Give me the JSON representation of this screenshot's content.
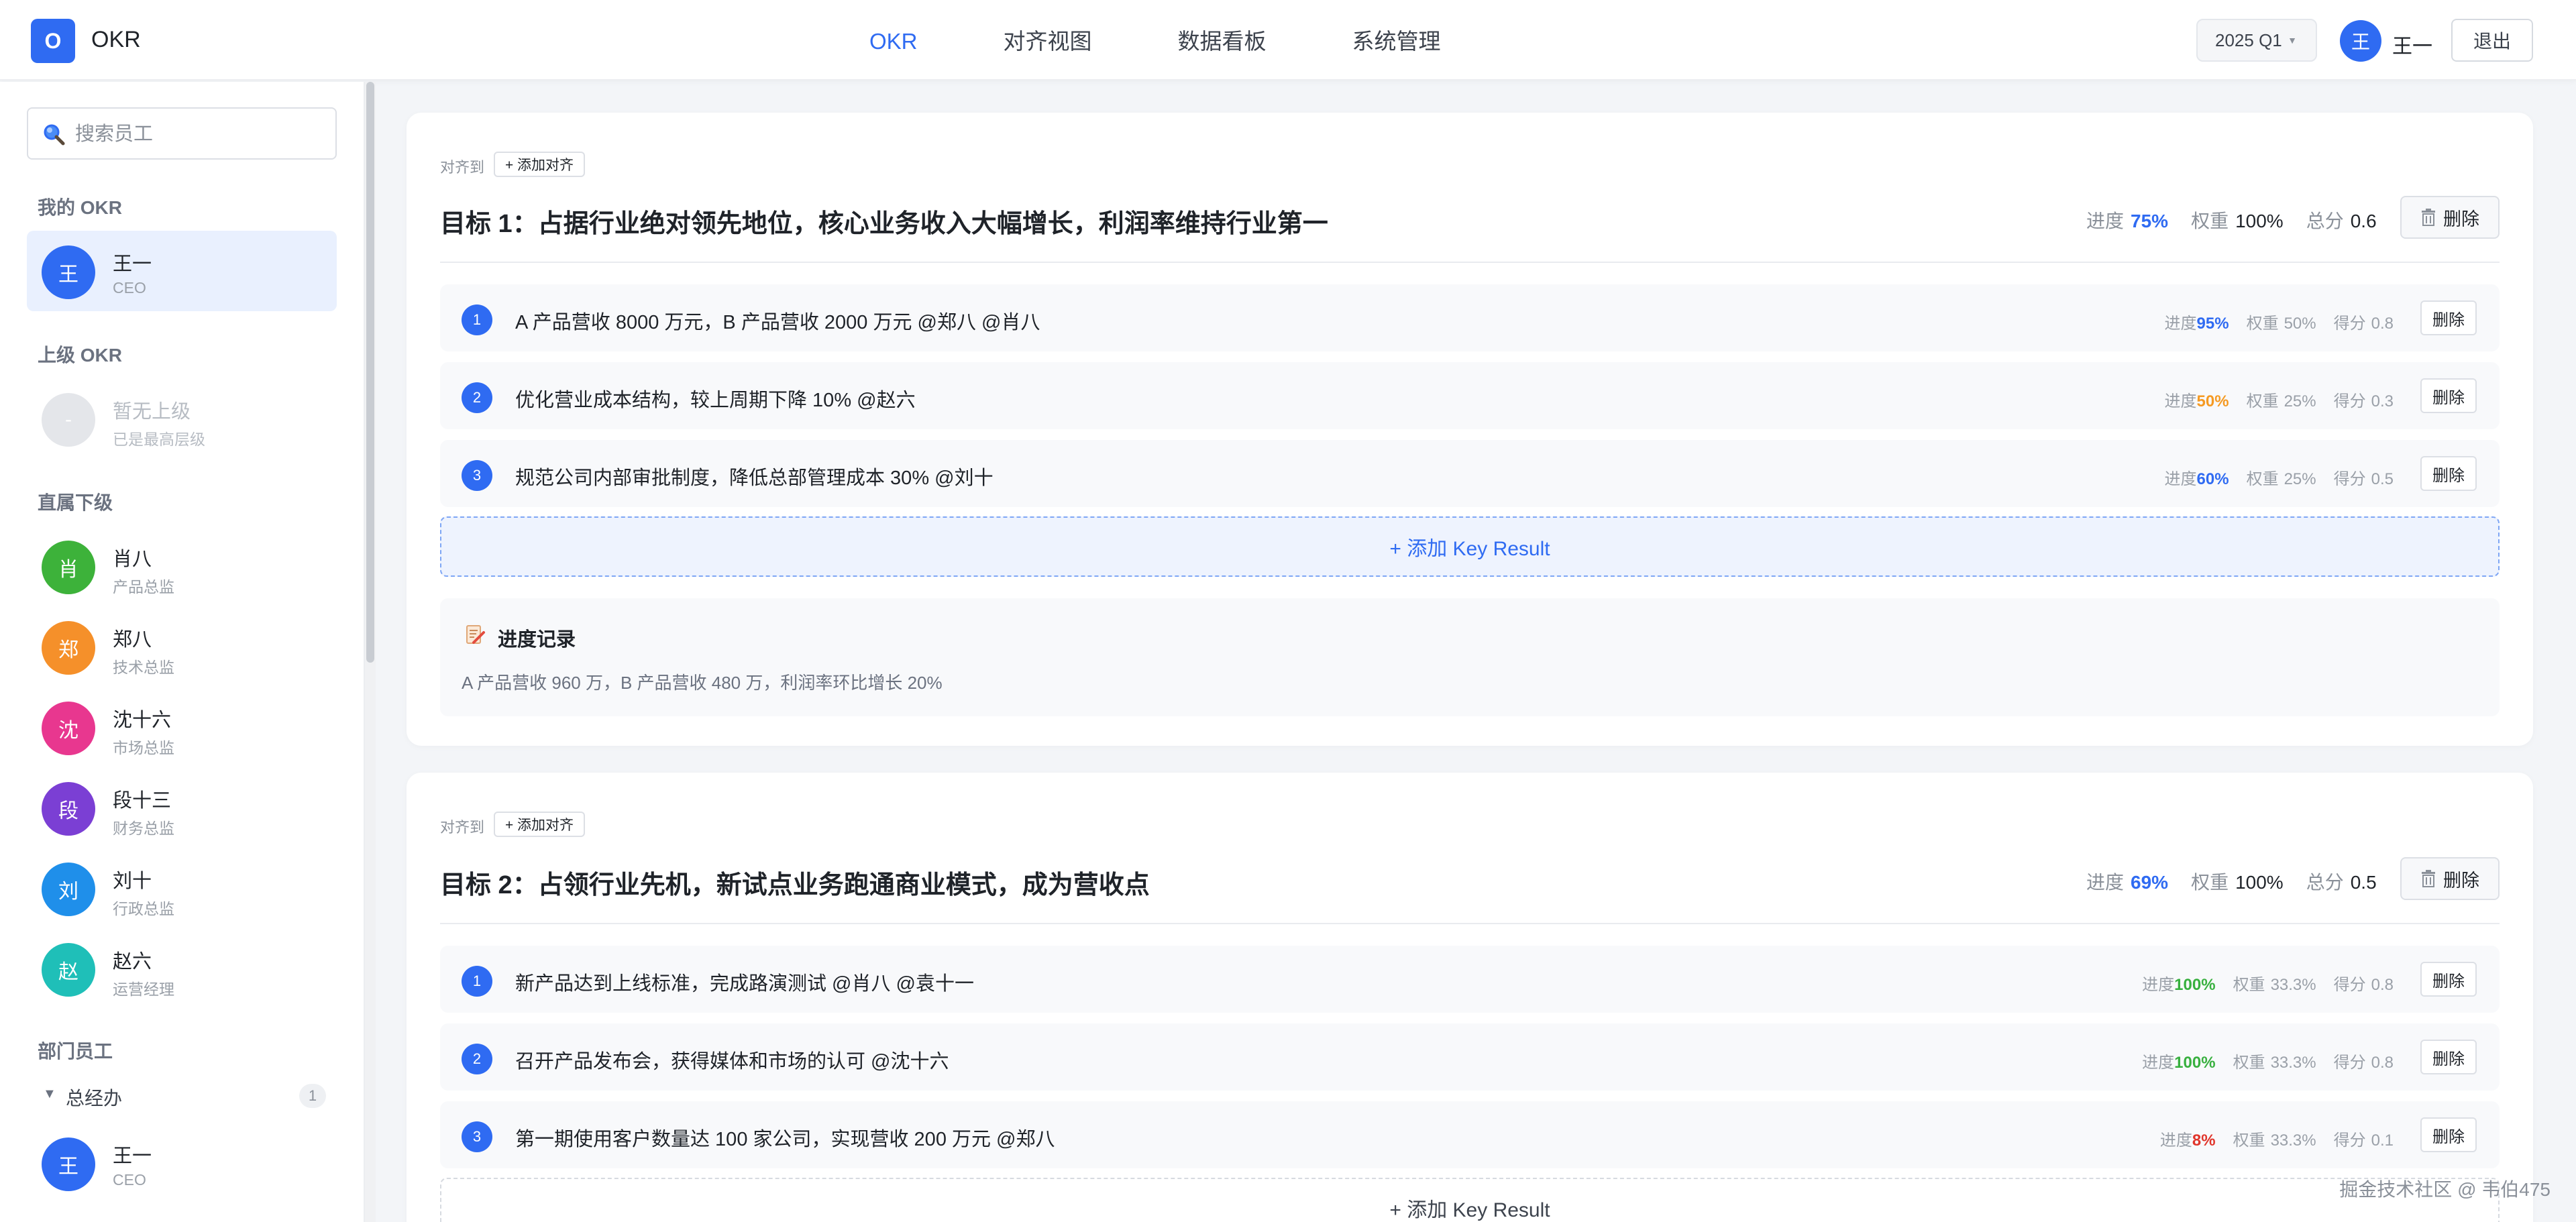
{
  "header": {
    "logo_letter": "O",
    "app_title": "OKR",
    "nav": [
      {
        "label": "OKR",
        "active": true
      },
      {
        "label": "对齐视图",
        "active": false
      },
      {
        "label": "数据看板",
        "active": false
      },
      {
        "label": "系统管理",
        "active": false
      }
    ],
    "quarter": "2025 Q1",
    "user_avatar": "王",
    "user_name": "王一",
    "logout_label": "退出"
  },
  "sidebar": {
    "search_placeholder": "搜索员工",
    "my_okr_label": "我的 OKR",
    "me": {
      "avatar": "王",
      "name": "王一",
      "role": "CEO",
      "color": "#2f6bf2"
    },
    "superior_label": "上级 OKR",
    "superior": {
      "avatar": "-",
      "name": "暂无上级",
      "role": "已是最高层级",
      "color": "#e4e6ea"
    },
    "subordinates_label": "直属下级",
    "subordinates": [
      {
        "avatar": "肖",
        "name": "肖八",
        "role": "产品总监",
        "color": "#3db23a"
      },
      {
        "avatar": "郑",
        "name": "郑八",
        "role": "技术总监",
        "color": "#f5902a"
      },
      {
        "avatar": "沈",
        "name": "沈十六",
        "role": "市场总监",
        "color": "#e8378f"
      },
      {
        "avatar": "段",
        "name": "段十三",
        "role": "财务总监",
        "color": "#7b3fd4"
      },
      {
        "avatar": "刘",
        "name": "刘十",
        "role": "行政总监",
        "color": "#1f8fea"
      },
      {
        "avatar": "赵",
        "name": "赵六",
        "role": "运营经理",
        "color": "#1fbfb8"
      }
    ],
    "department_label": "部门员工",
    "department": {
      "name": "总经办",
      "count": "1"
    },
    "department_member": {
      "avatar": "王",
      "name": "王一",
      "role": "CEO",
      "color": "#2f6bf2"
    }
  },
  "objectives": [
    {
      "align_label": "对齐到",
      "add_align_label": "+ 添加对齐",
      "title": "目标 1：占据行业绝对领先地位，核心业务收入大幅增长，利润率维持行业第一",
      "progress_label": "进度",
      "progress": "75%",
      "weight_label": "权重",
      "weight": "100%",
      "score_label": "总分",
      "score": "0.6",
      "delete_label": "删除",
      "key_results": [
        {
          "num": "1",
          "text": "A 产品营收 8000 万元，B 产品营收 2000 万元 @郑八 @肖八",
          "progress": "95%",
          "progress_color": "blue",
          "weight": "50%",
          "score": "0.8"
        },
        {
          "num": "2",
          "text": "优化营业成本结构，较上周期下降 10% @赵六",
          "progress": "50%",
          "progress_color": "orange",
          "weight": "25%",
          "score": "0.3"
        },
        {
          "num": "3",
          "text": "规范公司内部审批制度，降低总部管理成本 30% @刘十",
          "progress": "60%",
          "progress_color": "blue",
          "weight": "25%",
          "score": "0.5"
        }
      ],
      "add_kr_label": "+ 添加 Key Result",
      "progress_log": {
        "title": "进度记录",
        "text": "A 产品营收 960 万，B 产品营收 480 万，利润率环比增长 20%"
      }
    },
    {
      "align_label": "对齐到",
      "add_align_label": "+ 添加对齐",
      "title": "目标 2：占领行业先机，新试点业务跑通商业模式，成为营收点",
      "progress_label": "进度",
      "progress": "69%",
      "weight_label": "权重",
      "weight": "100%",
      "score_label": "总分",
      "score": "0.5",
      "delete_label": "删除",
      "key_results": [
        {
          "num": "1",
          "text": "新产品达到上线标准，完成路演测试 @肖八 @袁十一",
          "progress": "100%",
          "progress_color": "green",
          "weight": "33.3%",
          "score": "0.8"
        },
        {
          "num": "2",
          "text": "召开产品发布会，获得媒体和市场的认可 @沈十六",
          "progress": "100%",
          "progress_color": "green",
          "weight": "33.3%",
          "score": "0.8"
        },
        {
          "num": "3",
          "text": "第一期使用客户数量达 100 家公司，实现营收 200 万元 @郑八",
          "progress": "8%",
          "progress_color": "red",
          "weight": "33.3%",
          "score": "0.1"
        }
      ],
      "add_kr_label": "+ 添加 Key Result"
    }
  ],
  "kr_labels": {
    "progress": "进度",
    "weight": "权重",
    "score": "得分",
    "delete": "删除"
  },
  "footer_watermark": "掘金技术社区 @ 韦伯475"
}
